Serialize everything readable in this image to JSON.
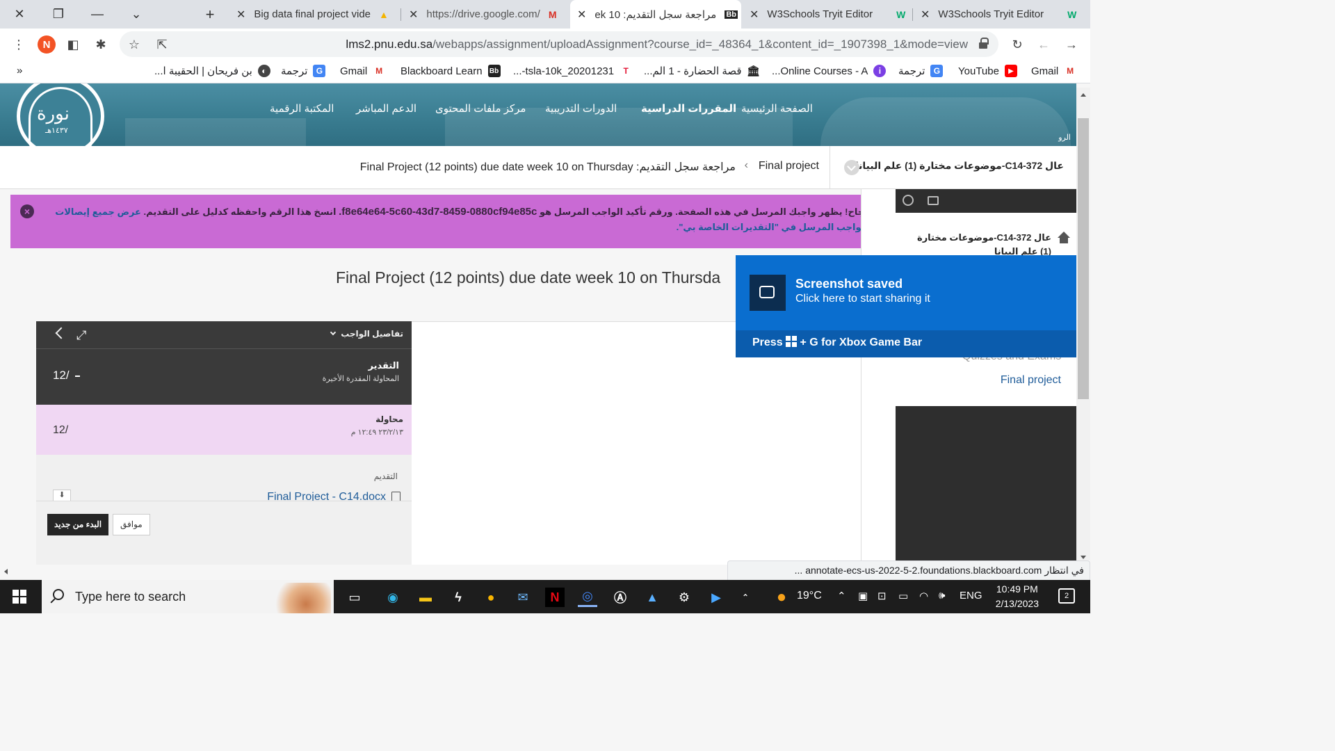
{
  "browser": {
    "tabs": [
      {
        "label": "Big data final project vide",
        "favicon": "drive-icon"
      },
      {
        "label": "https://drive.google.com/",
        "favicon": "gmail-icon"
      },
      {
        "label": "مراجعة سجل التقديم: 10 ek",
        "favicon": "Bb",
        "active": true
      },
      {
        "label": "W3Schools Tryit Editor",
        "favicon": "W"
      },
      {
        "label": "W3Schools Tryit Editor",
        "favicon": "W"
      }
    ],
    "new_tab": "+",
    "url_host": "lms2.pnu.edu.sa",
    "url_path": "/webapps/assignment/uploadAssignment?course_id=_48364_1&content_id=_1907398_1&mode=view",
    "profile_initial": "N",
    "bookmarks": [
      {
        "label": "Gmail",
        "icon": "M"
      },
      {
        "label": "YouTube",
        "icon": "▶"
      },
      {
        "label": "ترجمة",
        "icon": "G"
      },
      {
        "label": "Online Courses - A...",
        "icon": "i"
      },
      {
        "label": "قصة الحضارة - 1 الم...",
        "icon": "🏛"
      },
      {
        "label": "tsla-10k_20201231-...",
        "icon": "T"
      },
      {
        "label": "Blackboard Learn",
        "icon": "Bb"
      },
      {
        "label": "Gmail",
        "icon": "M"
      },
      {
        "label": "ترجمة",
        "icon": "G"
      },
      {
        "label": "بن فريحان | الحقيبة ا...",
        "icon": "◐"
      }
    ],
    "more_bookmarks": "»"
  },
  "site": {
    "logo_text": "نورة",
    "logo_year": "١٤٣٧هـ",
    "nav": [
      "الصفحة الرئيسية",
      "المقررات الدراسية",
      "الدورات التدريبية",
      "مركز ملفات المحتوى",
      "الدعم المباشر",
      "المكتبة الرقمية"
    ],
    "banner_tag": "الرو"
  },
  "breadcrumb": {
    "course": "عال C14-372-موضوعات مختارة (1) علم البيانا",
    "item1": "Final project",
    "item2": "مراجعة سجل التقديم: Final Project (12 points) due date week 10 on Thursday"
  },
  "success": {
    "prefix": "نجاح! يظهر واجبك المرسل في هذه الصفحة. ورقم تأكيد الواجب المرسل هو",
    "code": "f8e64e64-5c60-43d7-8459-0880cf94e85c.",
    "suffix": "انسخ هذا الرقم واحفظه كدليل على التقديم.",
    "link": "عرض جميع إيصالات الواجب المرسل في \"التقديرات الخاصة بي\".",
    "close": "×"
  },
  "sidebar": {
    "course": "عال C14-372-موضوعات مختارة (1) علم البيانا",
    "link_hidden": "Quizzes and Exams",
    "link_final": "Final project"
  },
  "main": {
    "title": "Final Project (12 points) due date week 10 on Thursda"
  },
  "panel": {
    "header": "تفاصيل الواجب",
    "grade_label": "التقدير",
    "grade_sub": "المحاولة المقدرة الأخيرة",
    "grade_value": "12/",
    "attempt_label": "محاولة",
    "attempt_time": "٢٣/٢/١٣ ١٢:٤٩ م",
    "attempt_value": "12/",
    "submission_label": "التقديم",
    "file_name": "Final Project - C14.docx",
    "btn_restart": "البدء من جديد",
    "btn_ok": "موافق"
  },
  "status_bar": "في انتظار annotate-ecs-us-2022-5-2.foundations.blackboard.com ...",
  "toast": {
    "title": "Screenshot saved",
    "subtitle": "Click here to start sharing it",
    "hint_prefix": "Press",
    "hint_suffix": "+ G for Xbox Game Bar"
  },
  "taskbar": {
    "search_placeholder": "Type here to search",
    "temperature": "19°C",
    "language": "ENG",
    "time": "10:49 PM",
    "date": "2/13/2023",
    "notifications": "2"
  },
  "colors": {
    "success_bg": "#c96ad4",
    "toast_bg": "#0a6ecf",
    "link": "#1f5c99",
    "banner": "#3a7d91"
  }
}
